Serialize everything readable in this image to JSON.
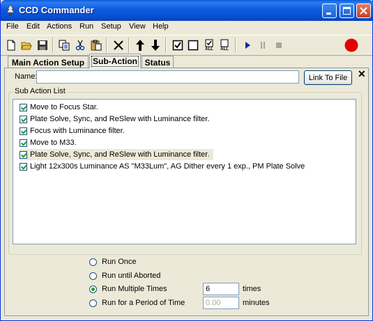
{
  "window": {
    "title": "CCD Commander"
  },
  "menu": [
    "File",
    "Edit",
    "Actions",
    "Run",
    "Setup",
    "View",
    "Help"
  ],
  "toolbar": {
    "tools": [
      "new-file-icon",
      "open-folder-icon",
      "save-icon",
      "copy-icon",
      "cut-icon",
      "paste-icon",
      "delete-icon",
      "move-up-icon",
      "move-down-icon",
      "check-icon",
      "uncheck-icon",
      "check-all-icon",
      "uncheck-all-icon",
      "play-icon",
      "pause-icon",
      "stop-icon",
      "record-status-icon"
    ],
    "all_label": "ALL",
    "record_color": "#E30000"
  },
  "tabs": [
    "Main Action Setup",
    "Sub-Action",
    "Status"
  ],
  "active_tab": "Sub-Action",
  "name_field": {
    "label": "Name:",
    "value": ""
  },
  "link_button": "Link To File",
  "close_glyph": "✕",
  "sub_action_list": {
    "title": "Sub Action List",
    "items": [
      {
        "label": "Move to Focus Star.",
        "checked": true
      },
      {
        "label": "Plate Solve, Sync, and ReSlew with Luminance filter.",
        "checked": true
      },
      {
        "label": "Focus with Luminance filter.",
        "checked": true
      },
      {
        "label": "Move to M33.",
        "checked": true
      },
      {
        "label": "Plate Solve, Sync, and ReSlew with Luminance filter.",
        "checked": true,
        "selected": true
      },
      {
        "label": "Light 12x300s Luminance AS \"M33Lum\", AG Dither every 1 exp., PM Plate Solve",
        "checked": true
      }
    ]
  },
  "run_options": {
    "options": [
      "Run Once",
      "Run until Aborted",
      "Run Multiple Times",
      "Run for a Period of Time"
    ],
    "selected": "Run Multiple Times",
    "times_value": "6",
    "times_unit": "times",
    "minutes_value": "0.00",
    "minutes_unit": "minutes"
  }
}
